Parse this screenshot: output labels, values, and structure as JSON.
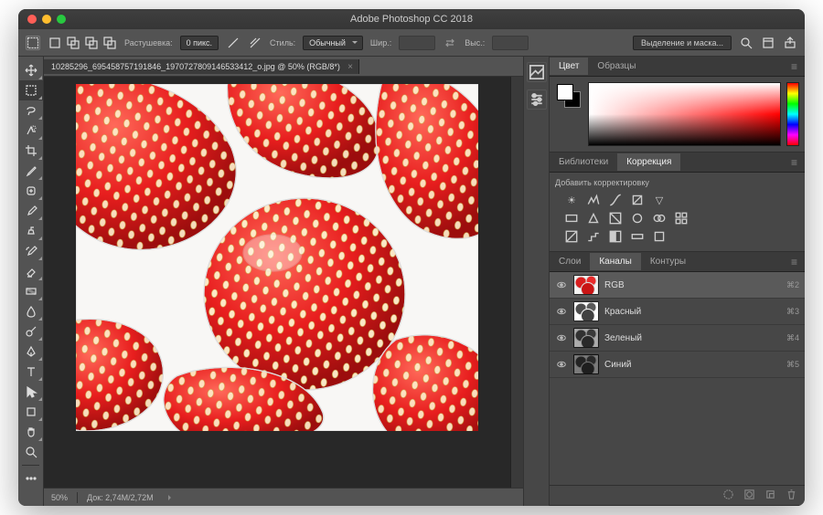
{
  "app": {
    "title": "Adobe Photoshop CC 2018"
  },
  "optionsbar": {
    "feather_label": "Растушевка:",
    "feather_value": "0 пикс.",
    "style_label": "Стиль:",
    "style_value": "Обычный",
    "width_label": "Шир.:",
    "width_value": "",
    "height_label": "Выс.:",
    "height_value": "",
    "select_mask_button": "Выделение и маска..."
  },
  "document": {
    "tab_title": "10285296_695458757191846_1970727809146533412_o.jpg @ 50% (RGB/8*)"
  },
  "status": {
    "zoom_value": "50%",
    "doc_info": "Док: 2,74M/2,72M"
  },
  "panel_color": {
    "tab_color": "Цвет",
    "tab_swatches": "Образцы"
  },
  "panel_adjust": {
    "tab_libraries": "Библиотеки",
    "tab_adjustments": "Коррекция",
    "add_label": "Добавить корректировку"
  },
  "panel_channels": {
    "tab_layers": "Слои",
    "tab_channels": "Каналы",
    "tab_paths": "Контуры",
    "items": [
      {
        "name": "RGB",
        "shortcut": "⌘2",
        "thumb_filter": "none"
      },
      {
        "name": "Красный",
        "shortcut": "⌘3",
        "thumb_filter": "grayscale(1) brightness(1.1)"
      },
      {
        "name": "Зеленый",
        "shortcut": "⌘4",
        "thumb_filter": "grayscale(1) brightness(0.7)"
      },
      {
        "name": "Синий",
        "shortcut": "⌘5",
        "thumb_filter": "grayscale(1) brightness(0.5)"
      }
    ]
  }
}
